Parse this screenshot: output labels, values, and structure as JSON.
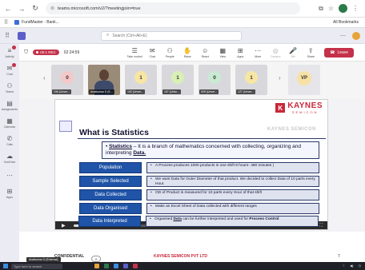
{
  "browser": {
    "url": "teams.microsoft.com/v2/?meetingjoin=true",
    "bookmark_1": "FundMaster - Bank...",
    "all_bookmarks": "All Bookmarks"
  },
  "teams": {
    "search_placeholder": "Search (Ctrl+Alt+E)"
  },
  "rail": [
    {
      "glyph": "≡",
      "label": "Activity"
    },
    {
      "glyph": "✉",
      "label": "Chat"
    },
    {
      "glyph": "⚇",
      "label": "Teams"
    },
    {
      "glyph": "▤",
      "label": "Assignments"
    },
    {
      "glyph": "▦",
      "label": "Calendar"
    },
    {
      "glyph": "✆",
      "label": "Calls"
    },
    {
      "glyph": "☁",
      "label": "OneDrive"
    },
    {
      "glyph": "⋯",
      "label": ""
    },
    {
      "glyph": "⊞",
      "label": "Apps"
    }
  ],
  "meeting": {
    "rec_label": "00:1  REC",
    "timer": "02:24:59",
    "tools": [
      {
        "glyph": "☰",
        "label": "Take control"
      },
      {
        "glyph": "✉",
        "label": "Chat"
      },
      {
        "glyph": "⚇",
        "label": "People"
      },
      {
        "glyph": "✋",
        "label": "Raise"
      },
      {
        "glyph": "☺",
        "label": "React"
      },
      {
        "glyph": "▦",
        "label": "View"
      },
      {
        "glyph": "⊞",
        "label": "Apps"
      },
      {
        "glyph": "⋯",
        "label": "More"
      },
      {
        "glyph": "◎",
        "label": "Camera"
      },
      {
        "glyph": "🎤",
        "label": "Mic"
      },
      {
        "glyph": "⇪",
        "label": "Share"
      }
    ],
    "leave_label": "Leave"
  },
  "participants": [
    {
      "type": "num",
      "value": "0",
      "name": "196 (Unver...",
      "circle": "#f4c7c9"
    },
    {
      "type": "video",
      "name": "Anatkumar D (E..."
    },
    {
      "type": "num",
      "value": "1",
      "name": "192 (Unver...",
      "circle": "#f7e6a3"
    },
    {
      "type": "num",
      "value": "1",
      "name": "197 (Unkn... ",
      "circle": "#d9f0b5"
    },
    {
      "type": "num",
      "value": "0",
      "name": "029 (Unver...",
      "circle": "#c8ead2"
    },
    {
      "type": "num",
      "value": "1",
      "name": "127 (Unver...",
      "circle": "#f7e6a3"
    },
    {
      "type": "vp",
      "value": "VP",
      "name": "",
      "circle": "#f7e1a5"
    }
  ],
  "slide": {
    "brand_main": "KAYNES",
    "brand_sub": "SEMICON",
    "title": "What is Statistics",
    "watermark": "KAYNES SEMICON",
    "definition_term": "Statistics",
    "definition_mid": " – It is a branch of mathematics concerned with collecting, organizing and interpreting ",
    "definition_end": "Data.",
    "rows": [
      {
        "label": "Population",
        "text": "A Process produces 1000 products in one shift  8 hours- 480 minutes )"
      },
      {
        "label": "Sample Selected",
        "text": "We want Data for Outer Diameter of that product. We decided to collect Data of 10 parts every Hour."
      },
      {
        "label": "Data Collected",
        "text": "OD of Product is measured for 10 parts every Hour of that shift"
      },
      {
        "label": "Data Organised",
        "text": "Make an Excel Sheet of Data collected with different ranges"
      },
      {
        "label": "Data Interpreted",
        "text_a": "Organised ",
        "text_b": "Data",
        "text_c": " can be further interpreted and used for ",
        "text_d": "Process Control"
      }
    ],
    "progress": 0.06
  },
  "footer": {
    "confidential": "CONFIDENTIAL",
    "company": "KAYNES SEMICON PVT LTD",
    "page": "7",
    "presenter": "Anatkumar D (External)"
  },
  "taskbar": {
    "search": "Type here to search"
  }
}
